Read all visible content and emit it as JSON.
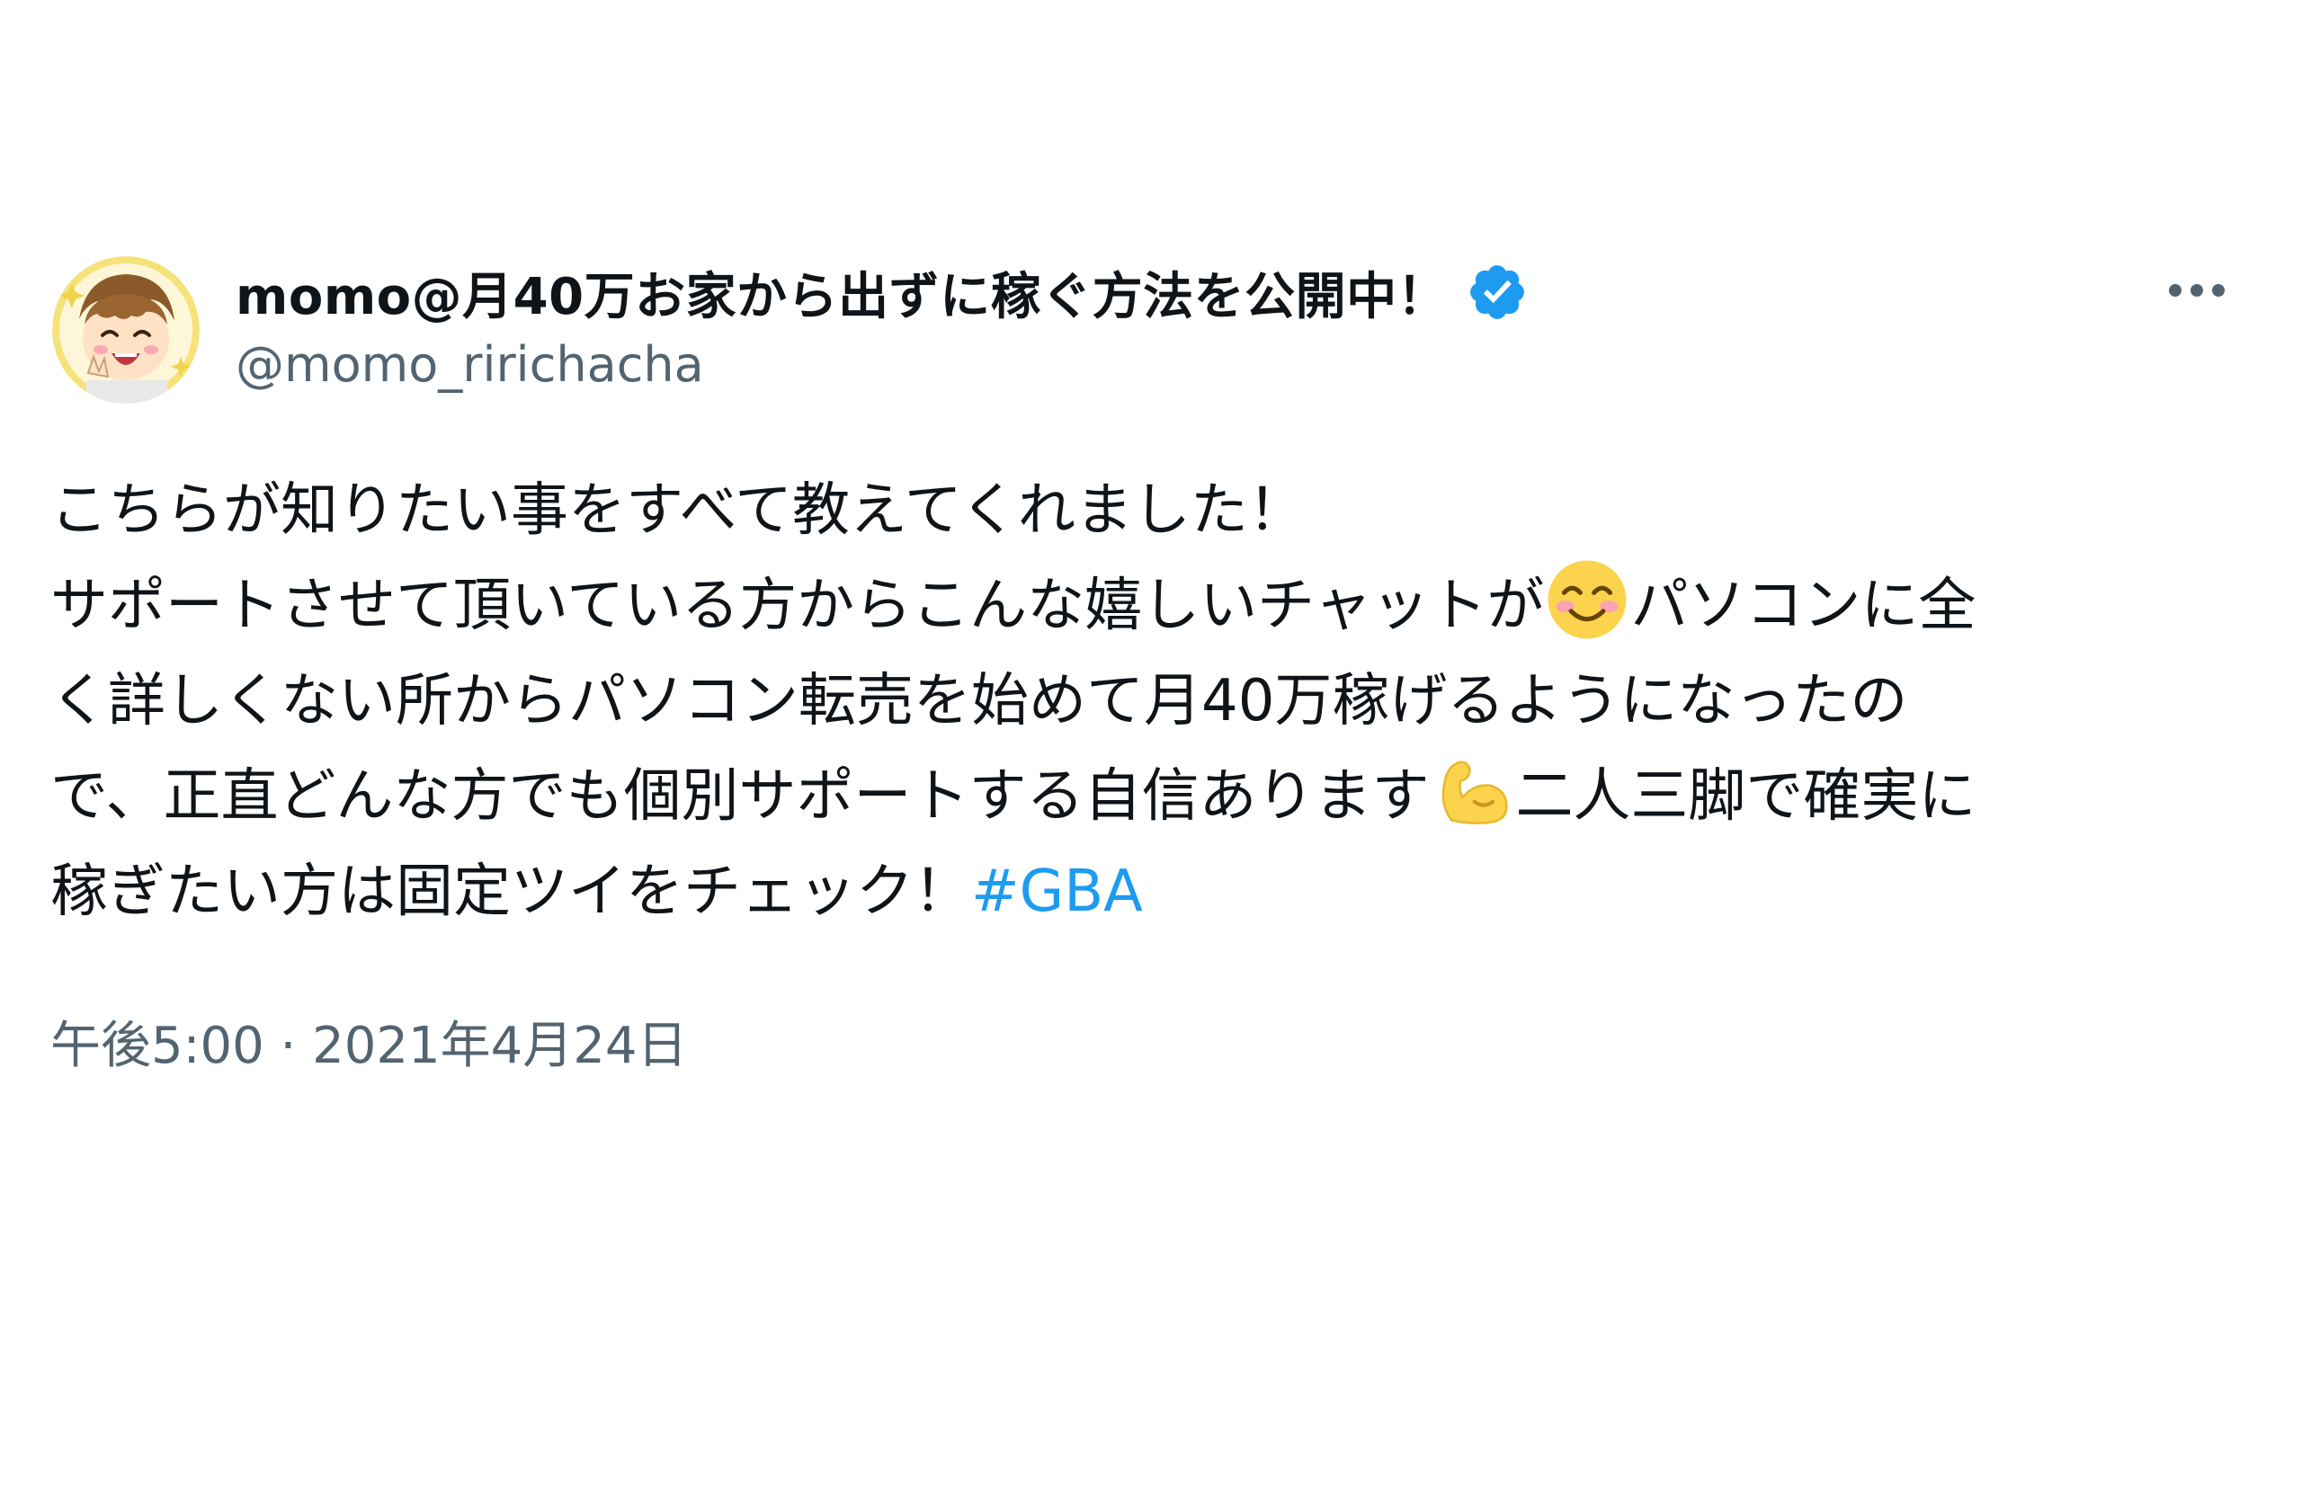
{
  "author": {
    "display_name": "momo@月40万お家から出ずに稼ぐ方法を公開中！",
    "handle": "@momo_ririchacha",
    "avatar": "avatar-illustration",
    "verified_icon": "verified-badge-icon",
    "verified_color": "#1d9bf0"
  },
  "menu": {
    "more_icon": "more-horizontal-icon"
  },
  "tweet": {
    "lines": [
      {
        "text_before": "こちらが知りたい事をすべて教えてくれました！"
      },
      {
        "text_before": "サポートさせて頂いている方からこんな嬉しいチャットが",
        "emoji": "smiling-face-emoji",
        "text_after": "パソコンに全"
      },
      {
        "text_before": "く詳しくない所からパソコン転売を始めて月40万稼げるようになったの"
      },
      {
        "text_before": "で、正直どんな方でも個別サポートする自信あります",
        "emoji": "flexed-biceps-emoji",
        "text_after": "二人三脚で確実に"
      },
      {
        "text_before": "稼ぎたい方は固定ツイをチェック！",
        "hashtag": "#GBA"
      }
    ],
    "hashtag_color": "#1d9bf0"
  },
  "timestamp": "午後5:00 · 2021年4月24日",
  "colors": {
    "text_primary": "#0f1419",
    "text_secondary": "#536471"
  }
}
